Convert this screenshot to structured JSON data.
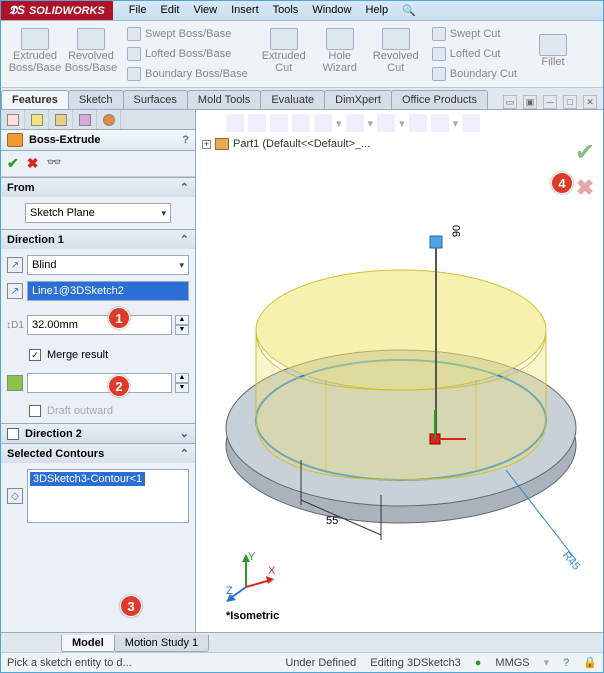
{
  "app": {
    "name": "SOLIDWORKS"
  },
  "menu": [
    "File",
    "Edit",
    "View",
    "Insert",
    "Tools",
    "Window",
    "Help"
  ],
  "ribbon": {
    "big": [
      "Extruded Boss/Base",
      "Revolved Boss/Base"
    ],
    "g1": [
      "Swept Boss/Base",
      "Lofted Boss/Base",
      "Boundary Boss/Base"
    ],
    "big2": [
      "Extruded Cut",
      "Hole Wizard",
      "Revolved Cut"
    ],
    "g2": [
      "Swept Cut",
      "Lofted Cut",
      "Boundary Cut"
    ],
    "fillet": "Fillet"
  },
  "tabs": [
    "Features",
    "Sketch",
    "Surfaces",
    "Mold Tools",
    "Evaluate",
    "DimXpert",
    "Office Products"
  ],
  "feature": {
    "title": "Boss-Extrude",
    "from_hdr": "From",
    "from_sel": "Sketch Plane",
    "dir1_hdr": "Direction 1",
    "dir1_type": "Blind",
    "dir1_vec": "Line1@3DSketch2",
    "dir1_dist": "32.00mm",
    "merge": "Merge result",
    "draft": "Draft outward",
    "dir2_hdr": "Direction 2",
    "selc_hdr": "Selected Contours",
    "selc_item": "3DSketch3-Contour<1"
  },
  "tree": "Part1 (Default<<Default>_...",
  "dims": {
    "a": "55",
    "b": "R45",
    "c": "90"
  },
  "view": "*Isometric",
  "annots": {
    "1": "1",
    "2": "2",
    "3": "3",
    "4": "4"
  },
  "btabs": [
    "Model",
    "Motion Study 1"
  ],
  "status": {
    "hint": "Pick a sketch entity to d...",
    "state": "Under Defined",
    "edit": "Editing 3DSketch3",
    "units": "MMGS",
    "help": "?"
  }
}
